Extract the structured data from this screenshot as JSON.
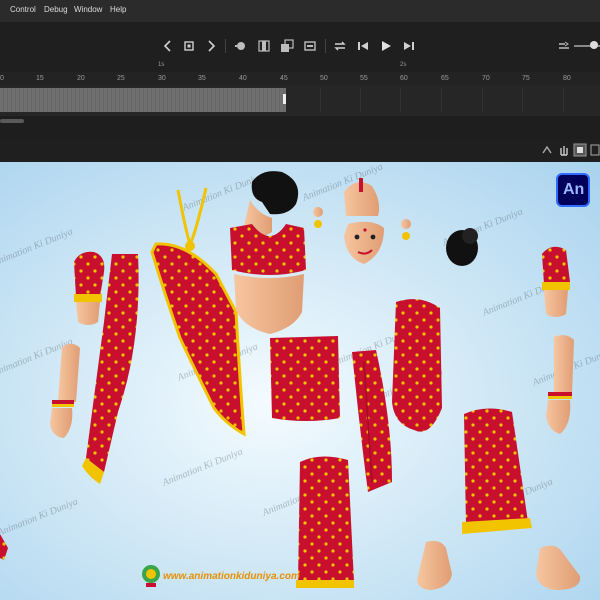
{
  "menu": {
    "control": "Control",
    "debug": "Debug",
    "window": "Window",
    "help": "Help"
  },
  "timeline": {
    "frame_labels": [
      "0",
      "15",
      "20",
      "25",
      "30",
      "35",
      "40",
      "45",
      "50",
      "55",
      "60",
      "65",
      "70",
      "75",
      "80"
    ],
    "second_markers": [
      "1s",
      "2s"
    ]
  },
  "stage": {
    "watermark": "Animation Ki Duniya",
    "app_badge": "An",
    "website": "www.animationkiduniya.com"
  },
  "colors": {
    "saree_red": "#c8102e",
    "border_yellow": "#f2c400",
    "skin": "#f3b58c",
    "app_badge_bg": "#00005b",
    "app_badge_border": "#2f6bff"
  }
}
